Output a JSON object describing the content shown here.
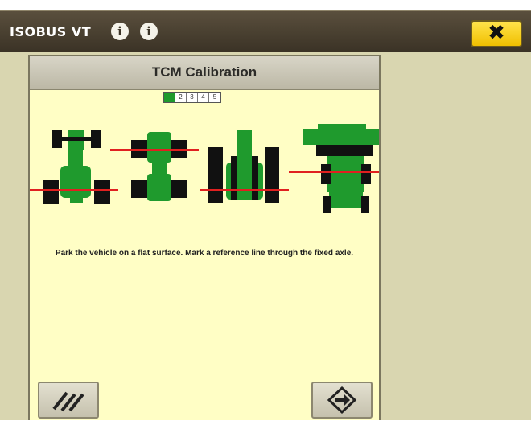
{
  "titlebar": {
    "title": "ISOBUS VT",
    "icons": [
      "info-icon",
      "info-icon"
    ],
    "close_label": "✖"
  },
  "panel": {
    "title": "TCM Calibration",
    "steps": [
      "1",
      "2",
      "3",
      "4",
      "5"
    ],
    "current_step": 1,
    "instruction": "Park the vehicle on a flat surface.  Mark a reference line through the fixed axle."
  },
  "vehicles": [
    "tractor-icon",
    "articulated-tractor-icon",
    "track-tractor-icon",
    "sprayer-icon"
  ],
  "buttons": {
    "left_icon": "cancel-slash-icon",
    "right_icon": "next-step-icon"
  },
  "colors": {
    "titlebar": "#3b3326",
    "panel_bg": "#fffec5",
    "vehicle_green": "#1f9a2d",
    "reference_line": "#e02020",
    "close_button": "#f5cf10"
  }
}
